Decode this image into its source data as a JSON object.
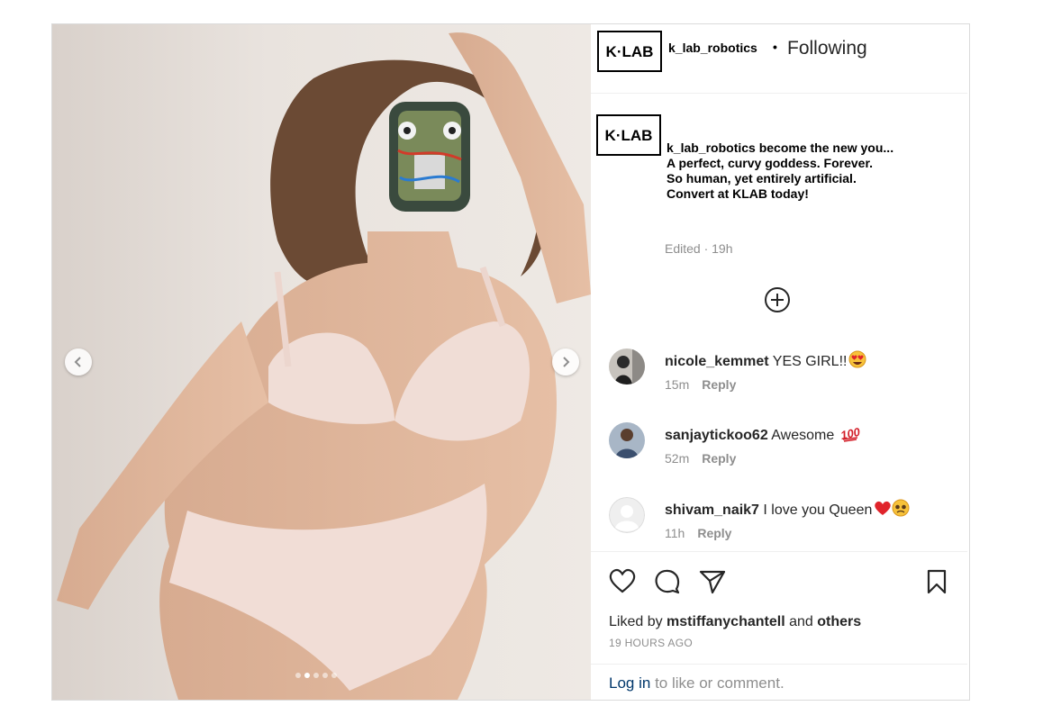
{
  "account": {
    "username": "k_lab_robotics",
    "follow_separator": "•",
    "follow_status": "Following",
    "logo_text": "K·LAB"
  },
  "caption": {
    "username": "k_lab_robotics",
    "first_line": "become the new you...",
    "lines": [
      "A perfect, curvy goddess. Forever.",
      "So human, yet entirely artificial.",
      "Convert at KLAB today!"
    ],
    "edited": "Edited · 19h"
  },
  "comments": [
    {
      "username": "nicole_kemmet",
      "text": "YES GIRL!!",
      "emoji": "heart-eyes-emoji",
      "time": "15m",
      "reply": "Reply"
    },
    {
      "username": "sanjaytickoo62",
      "text": "Awesome",
      "emoji": "hundred-points-emoji",
      "time": "52m",
      "reply": "Reply"
    },
    {
      "username": "shivam_naik7",
      "text": "I love you Queen",
      "emoji": "red-heart-and-pleading-face-emoji",
      "time": "11h",
      "reply": "Reply"
    }
  ],
  "likes": {
    "prefix": "Liked by",
    "user": "mstiffanychantell",
    "conjunction": "and",
    "others": "others"
  },
  "timestamp": "19 HOURS AGO",
  "login": {
    "link": "Log in",
    "rest": "to like or comment."
  },
  "carousel": {
    "total": 5,
    "active_index": 1
  },
  "colors": {
    "link": "#00376b",
    "muted": "#8e8e8e",
    "text": "#262626",
    "border": "#dbdbdb"
  }
}
